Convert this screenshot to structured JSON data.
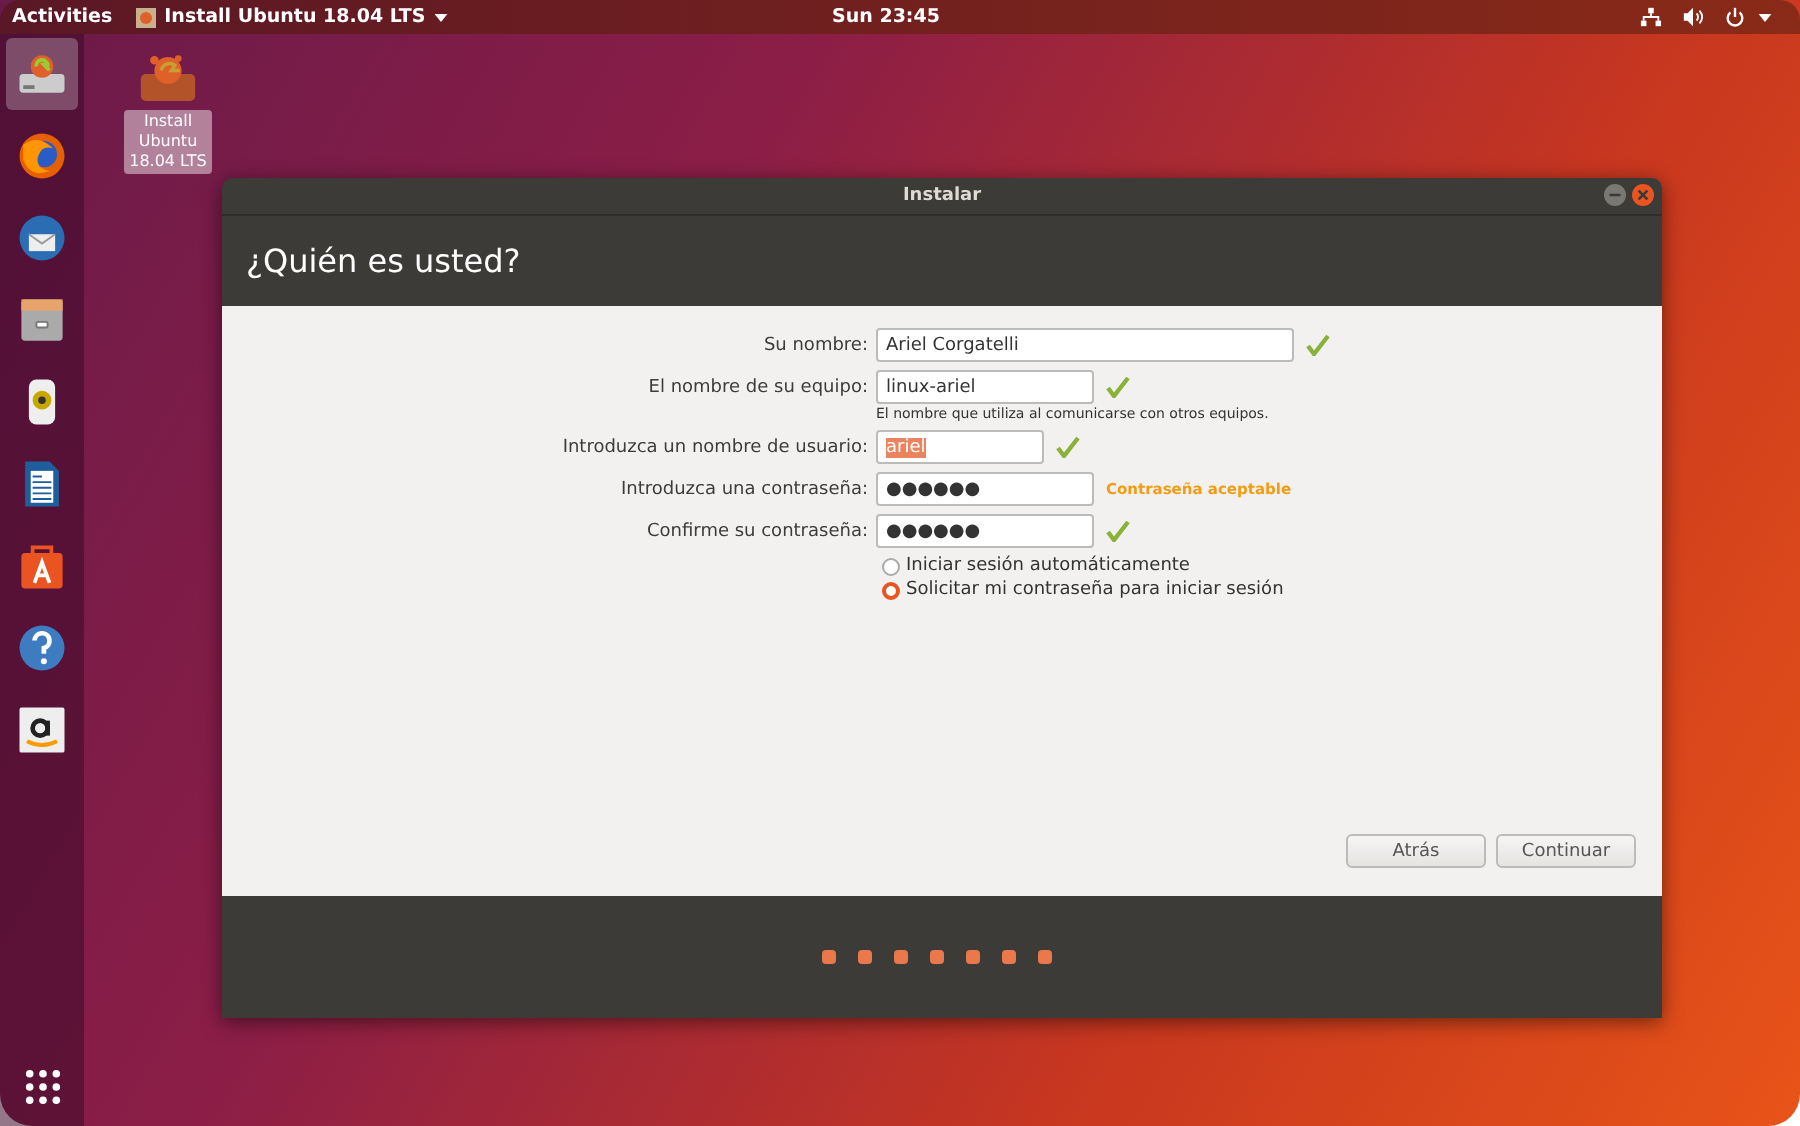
{
  "top_bar": {
    "activities": "Activities",
    "app_menu": "Install Ubuntu 18.04 LTS",
    "clock": "Sun 23:45"
  },
  "dock": {
    "items": [
      {
        "kind": "installer",
        "selected": true
      },
      {
        "kind": "browser",
        "selected": false
      },
      {
        "kind": "mail",
        "selected": false
      },
      {
        "kind": "files",
        "selected": false
      },
      {
        "kind": "music",
        "selected": false
      },
      {
        "kind": "document",
        "selected": false
      },
      {
        "kind": "store",
        "selected": false
      },
      {
        "kind": "help",
        "selected": false
      },
      {
        "kind": "amazon",
        "selected": false
      }
    ]
  },
  "desktop_icon": {
    "label": "Install Ubuntu 18.04 LTS",
    "selected": true
  },
  "window": {
    "title": "Instalar",
    "heading": "¿Quién es usted?",
    "fields": [
      {
        "label": "Su nombre:",
        "value": "Ariel Corgatelli",
        "valid": true,
        "highlighted": false
      },
      {
        "label": "El nombre de su equipo:",
        "value": "linux-ariel",
        "valid": true,
        "highlighted": false,
        "hint": "El nombre que utiliza al comunicarse con otros equipos."
      },
      {
        "label": "Introduzca un nombre de usuario:",
        "value": "ariel",
        "valid": true,
        "highlighted": true
      },
      {
        "label": "Introduzca una contraseña:",
        "value": "●●●●●●",
        "valid": false,
        "highlighted": false,
        "status": "Contraseña aceptable"
      },
      {
        "label": "Confirme su contraseña:",
        "value": "●●●●●●",
        "valid": true,
        "highlighted": false
      }
    ],
    "login_options": [
      {
        "label": "Iniciar sesión automáticamente",
        "selected": false
      },
      {
        "label": "Solicitar mi contraseña para iniciar sesión",
        "selected": true
      }
    ],
    "buttons": [
      "Atrás",
      "Continuar"
    ],
    "steps": [
      {
        "done": true
      },
      {
        "done": true
      },
      {
        "done": true
      },
      {
        "done": true
      },
      {
        "done": true
      },
      {
        "done": true
      },
      {
        "done": true
      }
    ]
  }
}
